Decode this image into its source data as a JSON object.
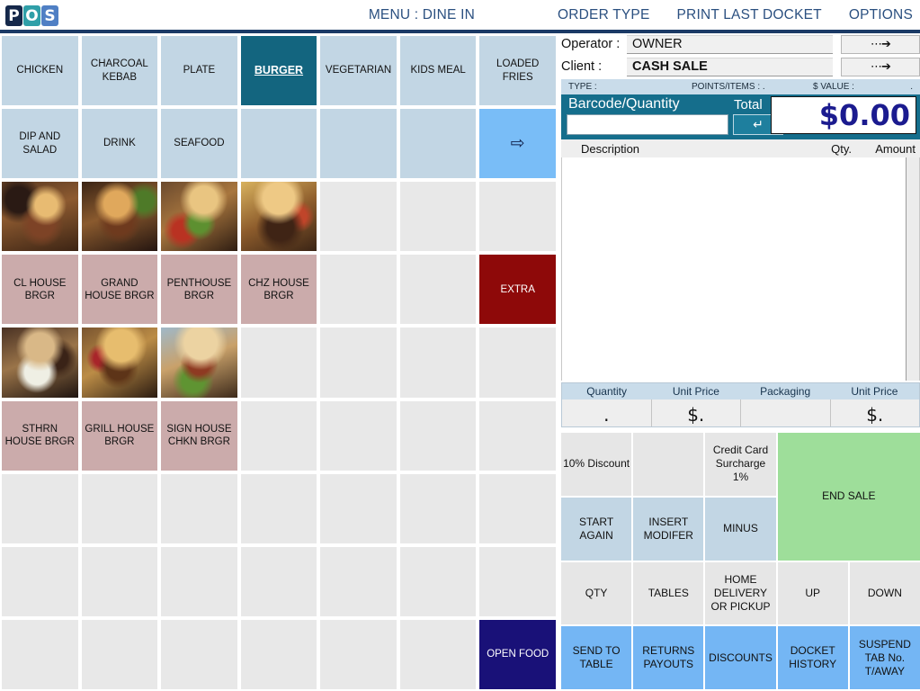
{
  "topbar": {
    "logo": [
      "P",
      "O",
      "S"
    ],
    "menu": [
      {
        "label": "MENU : DINE IN",
        "name": "menu-dine-in"
      },
      {
        "label": "ORDER TYPE",
        "name": "order-type"
      },
      {
        "label": "PRINT LAST DOCKET",
        "name": "print-last-docket"
      },
      {
        "label": "OPTIONS",
        "name": "options"
      }
    ]
  },
  "grid": {
    "columns": 7,
    "rows": 9,
    "cells": [
      {
        "label": "CHICKEN",
        "kind": "cat",
        "name": "category-chicken"
      },
      {
        "label": "CHARCOAL KEBAB",
        "kind": "cat",
        "name": "category-charcoal-kebab"
      },
      {
        "label": "PLATE",
        "kind": "cat",
        "name": "category-plate"
      },
      {
        "label": "BURGER",
        "kind": "cat-sel",
        "name": "category-burger"
      },
      {
        "label": "VEGETARIAN",
        "kind": "cat",
        "name": "category-vegetarian"
      },
      {
        "label": "KIDS MEAL",
        "kind": "cat",
        "name": "category-kids-meal"
      },
      {
        "label": "LOADED FRIES",
        "kind": "cat",
        "name": "category-loaded-fries"
      },
      {
        "label": "DIP AND SALAD",
        "kind": "cat",
        "name": "category-dip-and-salad"
      },
      {
        "label": "DRINK",
        "kind": "cat",
        "name": "category-drink"
      },
      {
        "label": "SEAFOOD",
        "kind": "cat",
        "name": "category-seafood"
      },
      {
        "label": "",
        "kind": "cat",
        "name": "category-blank-1"
      },
      {
        "label": "",
        "kind": "cat",
        "name": "category-blank-2"
      },
      {
        "label": "",
        "kind": "cat",
        "name": "category-blank-3"
      },
      {
        "label": "",
        "kind": "arrow",
        "name": "next-page-arrow"
      },
      {
        "label": "",
        "kind": "photo",
        "photo": "ph1",
        "name": "product-photo-1"
      },
      {
        "label": "",
        "kind": "photo",
        "photo": "ph2",
        "name": "product-photo-2"
      },
      {
        "label": "",
        "kind": "photo",
        "photo": "ph3",
        "name": "product-photo-3"
      },
      {
        "label": "",
        "kind": "photo",
        "photo": "ph4",
        "name": "product-photo-4"
      },
      {
        "label": "",
        "kind": "empty",
        "name": "empty-cell"
      },
      {
        "label": "",
        "kind": "empty",
        "name": "empty-cell"
      },
      {
        "label": "",
        "kind": "empty",
        "name": "empty-cell"
      },
      {
        "label": "CL HOUSE BRGR",
        "kind": "prod",
        "name": "product-cl-house-brgr"
      },
      {
        "label": "GRAND HOUSE BRGR",
        "kind": "prod",
        "name": "product-grand-house-brgr"
      },
      {
        "label": "PENTHOUSE BRGR",
        "kind": "prod",
        "name": "product-penthouse-brgr"
      },
      {
        "label": "CHZ HOUSE BRGR",
        "kind": "prod",
        "name": "product-chz-house-brgr"
      },
      {
        "label": "",
        "kind": "empty",
        "name": "empty-cell"
      },
      {
        "label": "",
        "kind": "empty",
        "name": "empty-cell"
      },
      {
        "label": "EXTRA",
        "kind": "extra",
        "name": "extra-button"
      },
      {
        "label": "",
        "kind": "photo",
        "photo": "ph5",
        "name": "product-photo-5"
      },
      {
        "label": "",
        "kind": "photo",
        "photo": "ph6",
        "name": "product-photo-6"
      },
      {
        "label": "",
        "kind": "photo",
        "photo": "ph7",
        "name": "product-photo-7"
      },
      {
        "label": "",
        "kind": "empty",
        "name": "empty-cell"
      },
      {
        "label": "",
        "kind": "empty",
        "name": "empty-cell"
      },
      {
        "label": "",
        "kind": "empty",
        "name": "empty-cell"
      },
      {
        "label": "",
        "kind": "empty",
        "name": "empty-cell"
      },
      {
        "label": "STHRN HOUSE BRGR",
        "kind": "prod",
        "name": "product-sthrn-house-brgr"
      },
      {
        "label": "GRILL HOUSE BRGR",
        "kind": "prod",
        "name": "product-grill-house-brgr"
      },
      {
        "label": "SIGN HOUSE CHKN BRGR",
        "kind": "prod",
        "name": "product-sign-house-chkn-brgr"
      },
      {
        "label": "",
        "kind": "empty",
        "name": "empty-cell"
      },
      {
        "label": "",
        "kind": "empty",
        "name": "empty-cell"
      },
      {
        "label": "",
        "kind": "empty",
        "name": "empty-cell"
      },
      {
        "label": "",
        "kind": "empty",
        "name": "empty-cell"
      },
      {
        "label": "",
        "kind": "empty",
        "name": "empty-cell"
      },
      {
        "label": "",
        "kind": "empty",
        "name": "empty-cell"
      },
      {
        "label": "",
        "kind": "empty",
        "name": "empty-cell"
      },
      {
        "label": "",
        "kind": "empty",
        "name": "empty-cell"
      },
      {
        "label": "",
        "kind": "empty",
        "name": "empty-cell"
      },
      {
        "label": "",
        "kind": "empty",
        "name": "empty-cell"
      },
      {
        "label": "",
        "kind": "empty",
        "name": "empty-cell"
      },
      {
        "label": "",
        "kind": "empty",
        "name": "empty-cell"
      },
      {
        "label": "",
        "kind": "empty",
        "name": "empty-cell"
      },
      {
        "label": "",
        "kind": "empty",
        "name": "empty-cell"
      },
      {
        "label": "",
        "kind": "empty",
        "name": "empty-cell"
      },
      {
        "label": "",
        "kind": "empty",
        "name": "empty-cell"
      },
      {
        "label": "",
        "kind": "empty",
        "name": "empty-cell"
      },
      {
        "label": "",
        "kind": "empty",
        "name": "empty-cell"
      },
      {
        "label": "",
        "kind": "empty",
        "name": "empty-cell"
      },
      {
        "label": "",
        "kind": "empty",
        "name": "empty-cell"
      },
      {
        "label": "",
        "kind": "empty",
        "name": "empty-cell"
      },
      {
        "label": "",
        "kind": "empty",
        "name": "empty-cell"
      },
      {
        "label": "",
        "kind": "empty",
        "name": "empty-cell"
      },
      {
        "label": "",
        "kind": "empty",
        "name": "empty-cell"
      },
      {
        "label": "OPEN FOOD",
        "kind": "openfood",
        "name": "open-food-button"
      }
    ]
  },
  "right": {
    "operator_label": "Operator :",
    "operator_value": "OWNER",
    "client_label": "Client :",
    "client_value": "CASH SALE",
    "operator_arrow": "⋯➔",
    "client_arrow": "⋯➔",
    "type_label": "TYPE :",
    "points_label": "POINTS/ITEMS : .",
    "value_label": "$ VALUE :",
    "value_amount": ".",
    "barcode_label": "Barcode/Quantity",
    "barcode_value": "",
    "barcode_placeholder": "",
    "enter_glyph": "↵",
    "total_label": "Total",
    "total_value": "$0.00",
    "columns": {
      "description": "Description",
      "qty": "Qty.",
      "amount": "Amount"
    },
    "receipt_lines": [],
    "qty_strip": {
      "headers": [
        "Quantity",
        "Unit Price",
        "Packaging",
        "Unit Price"
      ],
      "values": [
        ".",
        "$.",
        "",
        "$."
      ]
    },
    "actions": [
      {
        "label": "10% Discount",
        "kind": "grey",
        "name": "discount-10-percent-button"
      },
      {
        "label": "",
        "kind": "grey",
        "name": "action-blank-1"
      },
      {
        "label": "Credit Card Surcharge 1%",
        "kind": "grey",
        "name": "credit-card-surcharge-button"
      },
      {
        "label": "END SALE",
        "kind": "green",
        "span": true,
        "name": "end-sale-button"
      },
      {
        "label": "START AGAIN",
        "kind": "blue",
        "name": "start-again-button"
      },
      {
        "label": "INSERT MODIFER",
        "kind": "blue",
        "name": "insert-modifier-button"
      },
      {
        "label": "MINUS",
        "kind": "blue",
        "name": "minus-button"
      },
      {
        "label": "QTY",
        "kind": "grey",
        "name": "qty-button"
      },
      {
        "label": "TABLES",
        "kind": "grey",
        "name": "tables-button"
      },
      {
        "label": "HOME DELIVERY OR PICKUP",
        "kind": "grey",
        "name": "home-delivery-or-pickup-button"
      },
      {
        "label": "UP",
        "kind": "grey",
        "name": "up-button"
      },
      {
        "label": "DOWN",
        "kind": "grey",
        "name": "down-button"
      },
      {
        "label": "SEND TO TABLE",
        "kind": "cyan",
        "name": "send-to-table-button"
      },
      {
        "label": "RETURNS PAYOUTS",
        "kind": "cyan",
        "name": "returns-payouts-button"
      },
      {
        "label": "DISCOUNTS",
        "kind": "cyan",
        "name": "discounts-button"
      },
      {
        "label": "DOCKET HISTORY",
        "kind": "cyan",
        "name": "docket-history-button"
      },
      {
        "label": "SUSPEND TAB No. T/AWAY",
        "kind": "cyan",
        "name": "suspend-tab-button"
      }
    ]
  },
  "colors": {
    "accent_teal": "#13657f",
    "category_blue": "#c2d6e4",
    "product_rose": "#cbabab",
    "extra_red": "#8e0909",
    "open_food_navy": "#191178",
    "end_sale_green": "#9ede9a",
    "cyan_button": "#74b6f4",
    "barcode_bar": "#156e8c",
    "total_text": "#1b1b8f",
    "menu_text": "#2b5080",
    "rule_navy": "#1b3a66"
  }
}
